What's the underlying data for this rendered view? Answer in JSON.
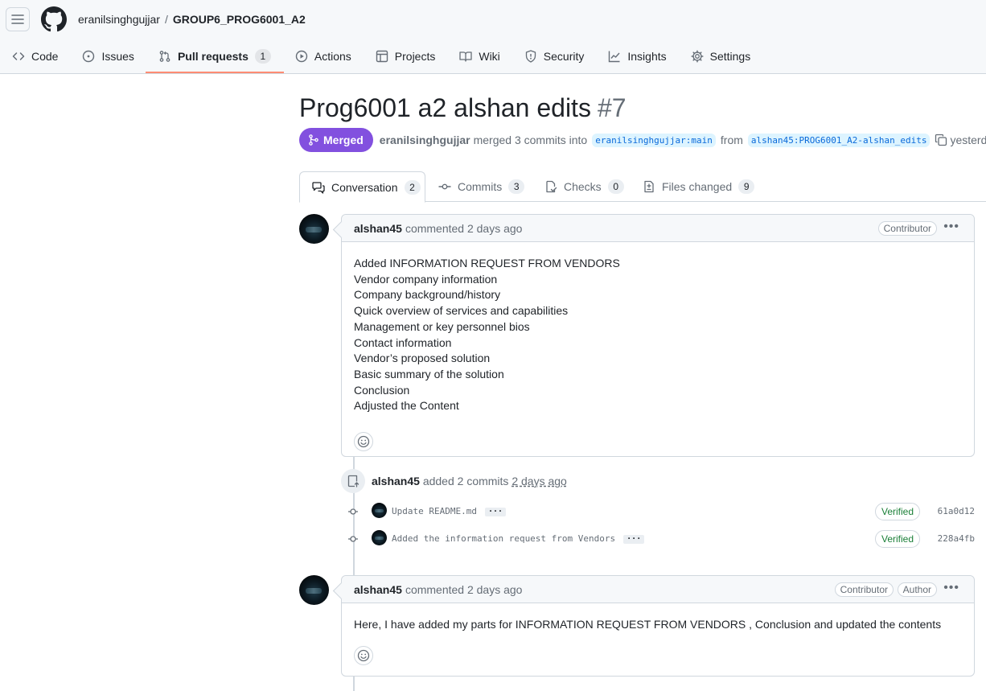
{
  "repo": {
    "owner": "eranilsinghgujjar",
    "separator": "/",
    "name": "GROUP6_PROG6001_A2"
  },
  "nav": {
    "items": [
      {
        "label": "Code",
        "icon": "code-icon"
      },
      {
        "label": "Issues",
        "icon": "issue-icon"
      },
      {
        "label": "Pull requests",
        "icon": "pull-request-icon",
        "count": "1",
        "active": true
      },
      {
        "label": "Actions",
        "icon": "play-icon"
      },
      {
        "label": "Projects",
        "icon": "table-icon"
      },
      {
        "label": "Wiki",
        "icon": "book-icon"
      },
      {
        "label": "Security",
        "icon": "shield-icon"
      },
      {
        "label": "Insights",
        "icon": "graph-icon"
      },
      {
        "label": "Settings",
        "icon": "gear-icon"
      }
    ]
  },
  "pr": {
    "title": "Prog6001 a2 alshan edits",
    "number": "#7",
    "state": "Merged",
    "author": "eranilsinghgujjar",
    "merge_text": "merged 3 commits into",
    "base_branch": "eranilsinghgujjar:main",
    "from_text": "from",
    "head_branch": "alshan45:PROG6001_A2-alshan_edits",
    "time": "yesterday"
  },
  "tabs": [
    {
      "label": "Conversation",
      "count": "2",
      "icon": "comment-discussion-icon"
    },
    {
      "label": "Commits",
      "count": "3",
      "icon": "git-commit-icon"
    },
    {
      "label": "Checks",
      "count": "0",
      "icon": "checklist-icon"
    },
    {
      "label": "Files changed",
      "count": "9",
      "icon": "file-diff-icon"
    }
  ],
  "comments": [
    {
      "user": "alshan45",
      "action": "commented 2 days ago",
      "labels": [
        "Contributor"
      ],
      "lines": [
        "Added INFORMATION REQUEST FROM VENDORS",
        "Vendor company information",
        "Company background/history",
        "Quick overview of services and capabilities",
        "Management or key personnel bios",
        "Contact information",
        "Vendor’s proposed solution",
        "Basic summary of the solution",
        "Conclusion",
        "Adjusted the Content"
      ]
    },
    {
      "user": "alshan45",
      "action": "commented 2 days ago",
      "labels": [
        "Contributor",
        "Author"
      ],
      "lines": [
        "Here, I have added my parts for INFORMATION REQUEST FROM VENDORS , Conclusion and updated the contents"
      ]
    }
  ],
  "commit_event": {
    "user": "alshan45",
    "action": "added 2 commits",
    "time": "2 days ago",
    "commits": [
      {
        "message": "Update README.md",
        "status": "Verified",
        "sha": "61a0d12"
      },
      {
        "message": "Added the information request from Vendors",
        "status": "Verified",
        "sha": "228a4fb"
      }
    ]
  },
  "colors": {
    "merged": "#8250df",
    "link": "#0969da",
    "verified": "#1a7f37",
    "active_tab_underline": "#fd8c73"
  }
}
